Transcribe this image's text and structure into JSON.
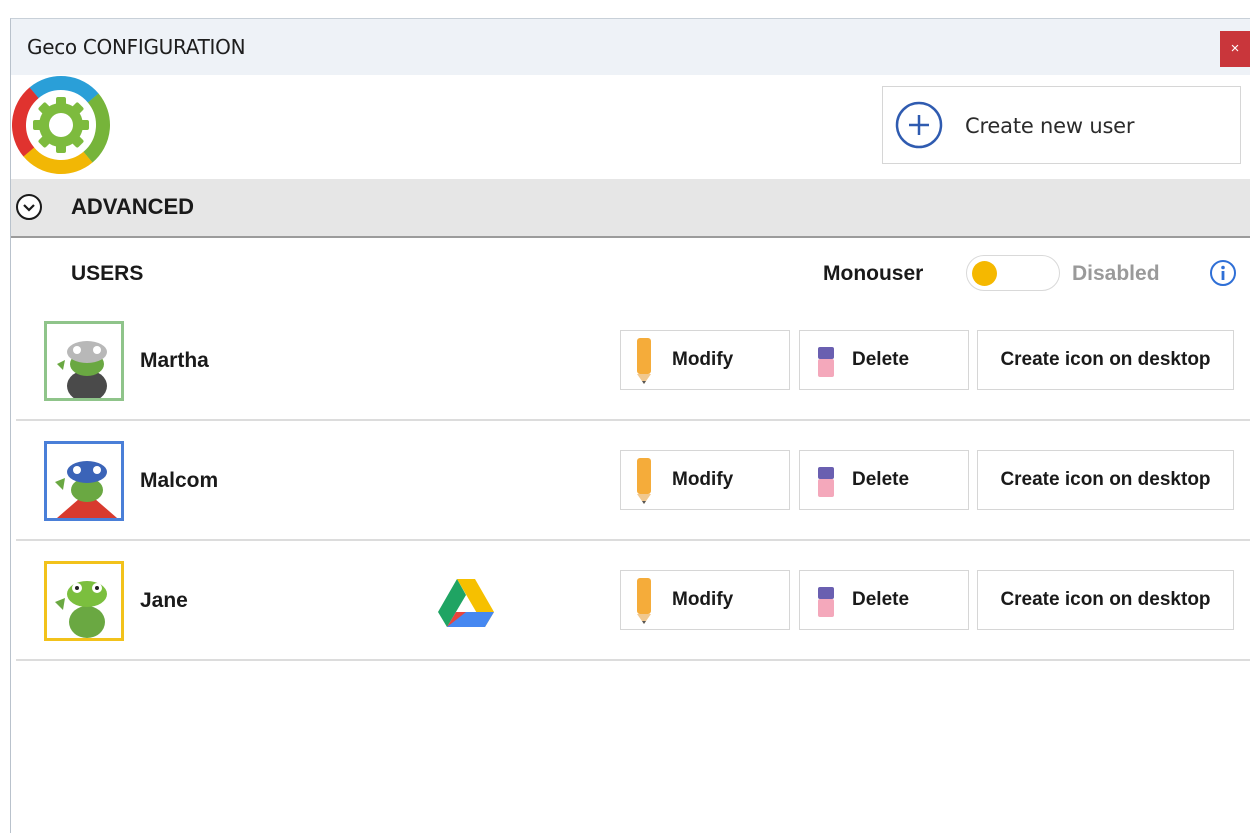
{
  "window": {
    "title": "Geco CONFIGURATION",
    "close_glyph": "×"
  },
  "header": {
    "logo_icon": "gear-logo-icon",
    "create_user_label": "Create new user",
    "create_user_icon": "plus-circle-icon"
  },
  "advanced": {
    "label": "ADVANCED",
    "icon": "chevron-down-circle-icon"
  },
  "users_section": {
    "heading": "USERS",
    "monouser_label": "Monouser",
    "monouser_state": "Disabled",
    "monouser_enabled": false,
    "info_icon": "info-icon"
  },
  "users": [
    {
      "name": "Martha",
      "avatar_color": "#8fc48a",
      "has_drive": false,
      "modify_label": "Modify",
      "delete_label": "Delete",
      "desktop_label": "Create icon on desktop"
    },
    {
      "name": "Malcom",
      "avatar_color": "#4a7fd8",
      "has_drive": false,
      "modify_label": "Modify",
      "delete_label": "Delete",
      "desktop_label": "Create icon on desktop"
    },
    {
      "name": "Jane",
      "avatar_color": "#f2c21b",
      "has_drive": true,
      "modify_label": "Modify",
      "delete_label": "Delete",
      "desktop_label": "Create icon on desktop"
    }
  ],
  "colors": {
    "accent_blue": "#2f5bb0",
    "toggle_knob": "#f5b800",
    "close_red": "#c9363b"
  }
}
